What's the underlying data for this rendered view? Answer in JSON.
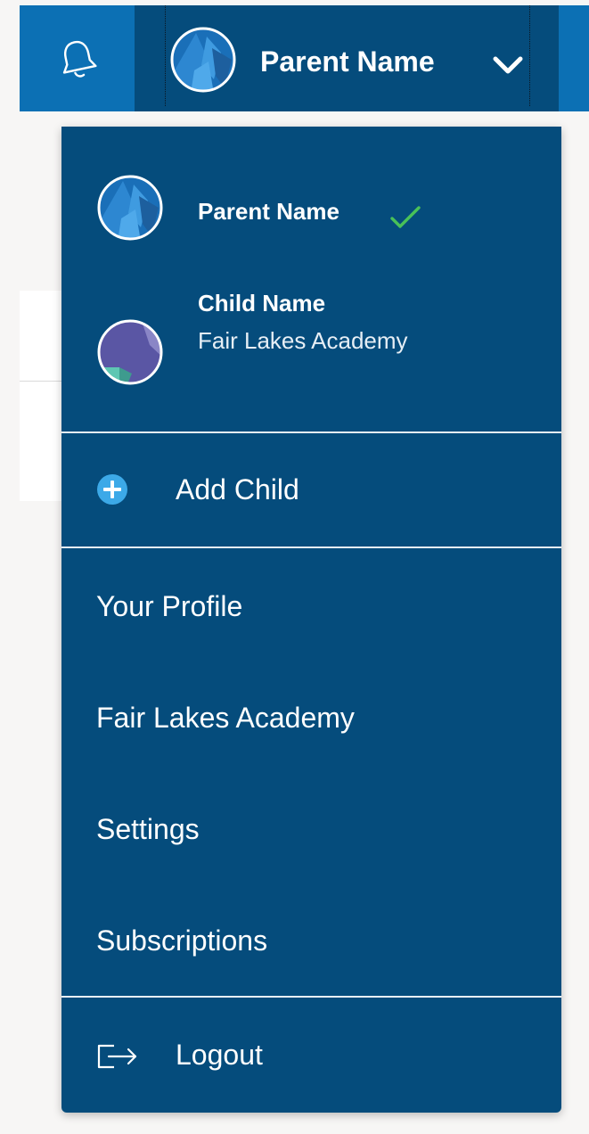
{
  "header": {
    "user_name": "Parent Name"
  },
  "dropdown": {
    "accounts": [
      {
        "name": "Parent Name",
        "subtitle": "",
        "selected": true
      },
      {
        "name": "Child Name",
        "subtitle": "Fair Lakes Academy",
        "selected": false
      }
    ],
    "add_child_label": "Add Child",
    "menu_items": [
      {
        "label": "Your Profile"
      },
      {
        "label": "Fair Lakes Academy"
      },
      {
        "label": "Settings"
      },
      {
        "label": "Subscriptions"
      }
    ],
    "logout_label": "Logout"
  },
  "icons": {
    "notifications": "bell-icon",
    "menu_toggle": "chevron-down-icon",
    "selected_account": "checkmark-icon",
    "add_child": "plus-circle-icon",
    "logout": "logout-icon"
  },
  "colors": {
    "header_blue": "#0c70b4",
    "menu_navy": "#054c7c",
    "check_green": "#49c158",
    "add_icon_blue": "#3ca9e8",
    "page_background": "#f7f6f5"
  }
}
